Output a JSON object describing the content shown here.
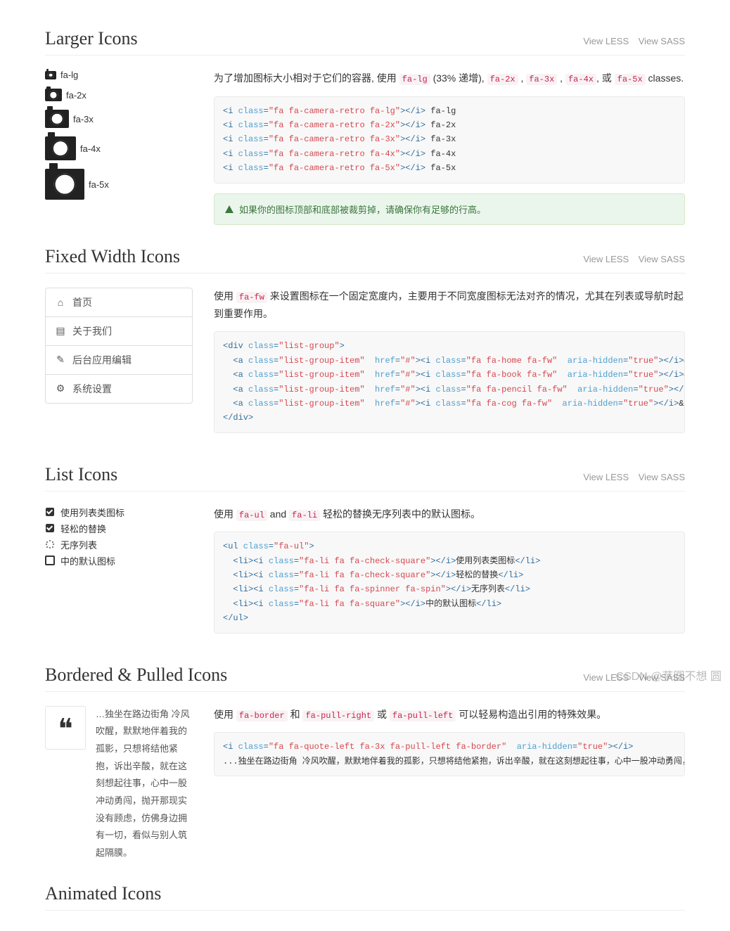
{
  "common": {
    "view_less": "View LESS",
    "view_sass": "View SASS"
  },
  "larger": {
    "title": "Larger Icons",
    "sizes": [
      {
        "cls": "sz-lg",
        "label": "fa-lg"
      },
      {
        "cls": "sz-2x",
        "label": "fa-2x"
      },
      {
        "cls": "sz-3x",
        "label": "fa-3x"
      },
      {
        "cls": "sz-4x",
        "label": "fa-4x"
      },
      {
        "cls": "sz-5x",
        "label": "fa-5x"
      }
    ],
    "desc_pre": "为了增加图标大小相对于它们的容器, 使用 ",
    "desc_lg": "fa-lg",
    "desc_lg_after": " (33% 递增), ",
    "c2": "fa-2x",
    "c3": "fa-3x",
    "c4": "fa-4x",
    "c_or": ", 或 ",
    "c5": "fa-5x",
    "desc_end": " classes.",
    "sep": " , ",
    "code": "<i class=\"fa fa-camera-retro fa-lg\"></i> fa-lg\n<i class=\"fa fa-camera-retro fa-2x\"></i> fa-2x\n<i class=\"fa fa-camera-retro fa-3x\"></i> fa-3x\n<i class=\"fa fa-camera-retro fa-4x\"></i> fa-4x\n<i class=\"fa fa-camera-retro fa-5x\"></i> fa-5x",
    "alert": "如果你的图标顶部和底部被裁剪掉，请确保你有足够的行高。"
  },
  "fixed": {
    "title": "Fixed Width Icons",
    "items": [
      {
        "icon": "icon-home",
        "label": "首页"
      },
      {
        "icon": "icon-book",
        "label": "关于我们"
      },
      {
        "icon": "icon-pencil",
        "label": "后台应用编辑"
      },
      {
        "icon": "icon-cog",
        "label": "系统设置"
      }
    ],
    "desc_pre": "使用 ",
    "desc_code": "fa-fw",
    "desc_post": " 来设置图标在一个固定宽度内，主要用于不同宽度图标无法对齐的情况，尤其在列表或导航时起到重要作用。",
    "code": "<div class=\"list-group\">\n  <a class=\"list-group-item\" href=\"#\"><i class=\"fa fa-home fa-fw\" aria-hidden=\"true\"></i>&nbsp; 首页</a>\n  <a class=\"list-group-item\" href=\"#\"><i class=\"fa fa-book fa-fw\" aria-hidden=\"true\"></i>&nbsp; 关于我们</a>\n  <a class=\"list-group-item\" href=\"#\"><i class=\"fa fa-pencil fa-fw\" aria-hidden=\"true\"></i>&nbsp; 后台应用编辑</a>\n  <a class=\"list-group-item\" href=\"#\"><i class=\"fa fa-cog fa-fw\" aria-hidden=\"true\"></i>&nbsp; 系统设置</a>\n</div>"
  },
  "list": {
    "title": "List Icons",
    "items": [
      {
        "type": "check",
        "label": "使用列表类图标"
      },
      {
        "type": "check",
        "label": "轻松的替换"
      },
      {
        "type": "spinner",
        "label": "无序列表"
      },
      {
        "type": "square",
        "label": "中的默认图标"
      }
    ],
    "desc_pre": "使用 ",
    "c1": "fa-ul",
    "and": " and ",
    "c2": "fa-li",
    "desc_post": " 轻松的替换无序列表中的默认图标。",
    "code": "<ul class=\"fa-ul\">\n  <li><i class=\"fa-li fa fa-check-square\"></i>使用列表类图标</li>\n  <li><i class=\"fa-li fa fa-check-square\"></i>轻松的替换</li>\n  <li><i class=\"fa-li fa fa-spinner fa-spin\"></i>无序列表</li>\n  <li><i class=\"fa-li fa fa-square\"></i>中的默认图标</li>\n</ul>"
  },
  "bordered": {
    "title": "Bordered & Pulled Icons",
    "quote_text": "…独坐在路边街角 冷风吹醒，默默地伴着我的孤影，只想将结他紧抱，诉出辛酸，就在这刻想起往事，心中一股冲动勇闯，抛开那现实没有顾虑，仿佛身边拥有一切，看似与别人筑起隔膜。",
    "desc_pre": "使用 ",
    "c1": "fa-border",
    "and": " 和 ",
    "c2": "fa-pull-right",
    "or": " 或 ",
    "c3": "fa-pull-left",
    "desc_post": " 可以轻易构造出引用的特殊效果。",
    "code": "<i class=\"fa fa-quote-left fa-3x fa-pull-left fa-border\" aria-hidden=\"true\"></i>\n...独坐在路边街角 冷风吹醒，默默地伴着我的孤影，只想将结他紧抱，诉出辛酸，就在这刻想起往事，心中一股冲动勇闯，抛开那现实没有顾虑，仿佛身边拥有一切，看似与别人筑起隔膜."
  },
  "animated": {
    "title": "Animated Icons"
  },
  "watermark": "CSDN @芋圆不想 圆"
}
